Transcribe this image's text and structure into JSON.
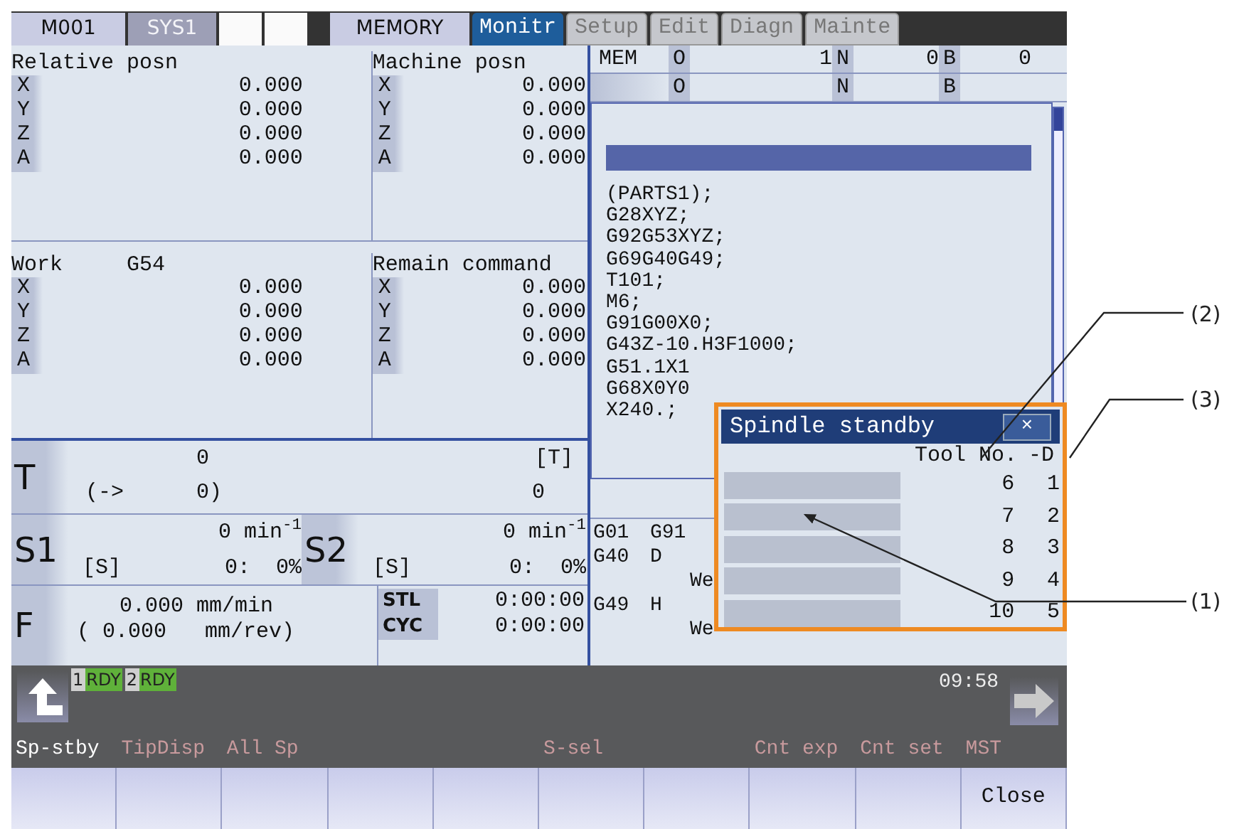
{
  "header": {
    "cells": [
      {
        "label": "M001",
        "kind": "info"
      },
      {
        "label": "SYS1",
        "kind": "system"
      },
      {
        "kind": "blank"
      },
      {
        "kind": "blank"
      }
    ],
    "mode": "MEMORY"
  },
  "screen_tabs": [
    {
      "label": "Monitr",
      "selected": true
    },
    {
      "label": "Setup",
      "selected": false
    },
    {
      "label": "Edit",
      "selected": false
    },
    {
      "label": "Diagn",
      "selected": false
    },
    {
      "label": "Mainte",
      "selected": false
    }
  ],
  "positions": [
    {
      "title": "Relative posn",
      "axes": [
        {
          "axis": "X",
          "value": "0.000"
        },
        {
          "axis": "Y",
          "value": "0.000"
        },
        {
          "axis": "Z",
          "value": "0.000"
        },
        {
          "axis": "A",
          "value": "0.000"
        }
      ]
    },
    {
      "title": "Machine posn",
      "axes": [
        {
          "axis": "X",
          "value": "0.000"
        },
        {
          "axis": "Y",
          "value": "0.000"
        },
        {
          "axis": "Z",
          "value": "0.000"
        },
        {
          "axis": "A",
          "value": "0.000"
        }
      ]
    },
    {
      "title": "Work",
      "subtitle": "G54",
      "axes": [
        {
          "axis": "X",
          "value": "0.000"
        },
        {
          "axis": "Y",
          "value": "0.000"
        },
        {
          "axis": "Z",
          "value": "0.000"
        },
        {
          "axis": "A",
          "value": "0.000"
        }
      ]
    },
    {
      "title": "Remain command",
      "axes": [
        {
          "axis": "X",
          "value": "0.000"
        },
        {
          "axis": "Y",
          "value": "0.000"
        },
        {
          "axis": "Z",
          "value": "0.000"
        },
        {
          "axis": "A",
          "value": "0.000"
        }
      ]
    }
  ],
  "tool": {
    "label": "T",
    "value": "0",
    "arrow": "(->",
    "next": "0)",
    "bracket": "[T]",
    "command": "0"
  },
  "spindles": [
    {
      "label": "S1",
      "speed": "0 min$^{-1}$",
      "s": "[S]",
      "gear": "0:  0%"
    },
    {
      "label": "S2",
      "speed": "0 min$^{-1}$",
      "s": "[S]",
      "gear": "0:  0%"
    }
  ],
  "feed": {
    "label": "F",
    "rate": "0.000 mm/min",
    "per_rev": "( 0.000   mm/rev)"
  },
  "times": [
    {
      "label": "STL",
      "value": "0:00:00"
    },
    {
      "label": "CYC",
      "value": "0:00:00"
    }
  ],
  "program_header": [
    {
      "mode": "MEM",
      "o_label": "O",
      "o": "1",
      "n_label": "N",
      "n": "0",
      "b_label": "B",
      "b": "0"
    },
    {
      "o_label": "O",
      "n_label": "N",
      "b_label": "B"
    }
  ],
  "program_lines": [
    "(PARTS1);",
    "G28XYZ;",
    "G92G53XYZ;",
    "G69G40G49;",
    "T101;",
    "M6;",
    "G91G00X0;",
    "G43Z-10.H3F1000;",
    "G51.1X1",
    "G68X0Y0",
    "X240.;"
  ],
  "modal": [
    {
      "code": "G01",
      "value": "G91"
    },
    {
      "code": "G40",
      "value": "D"
    },
    {
      "value": "We"
    },
    {
      "code": "G49",
      "value": "H"
    },
    {
      "value": "We"
    }
  ],
  "popup": {
    "title": "Spindle standby",
    "close": "×",
    "columns": [
      "Tool No.",
      "-D"
    ],
    "rows": [
      {
        "tool": "6",
        "d": "1"
      },
      {
        "tool": "7",
        "d": "2"
      },
      {
        "tool": "8",
        "d": "3"
      },
      {
        "tool": "9",
        "d": "4"
      },
      {
        "tool": "10",
        "d": "5"
      }
    ]
  },
  "status": {
    "systems": [
      {
        "num": "1",
        "state": "RDY"
      },
      {
        "num": "2",
        "state": "RDY"
      }
    ],
    "time": "09:58"
  },
  "soft_keys": [
    {
      "label": "Sp-stby",
      "enabled": true
    },
    {
      "label": "TipDisp",
      "enabled": false
    },
    {
      "label": "All Sp",
      "enabled": false
    },
    {
      "label": "S-sel",
      "enabled": false
    },
    {
      "label": "Cnt exp",
      "enabled": false
    },
    {
      "label": "Cnt set",
      "enabled": false
    },
    {
      "label": "MST",
      "enabled": false
    }
  ],
  "close_key": "Close",
  "callouts": [
    {
      "label": "(2)"
    },
    {
      "label": "(3)"
    },
    {
      "label": "(1)"
    }
  ]
}
